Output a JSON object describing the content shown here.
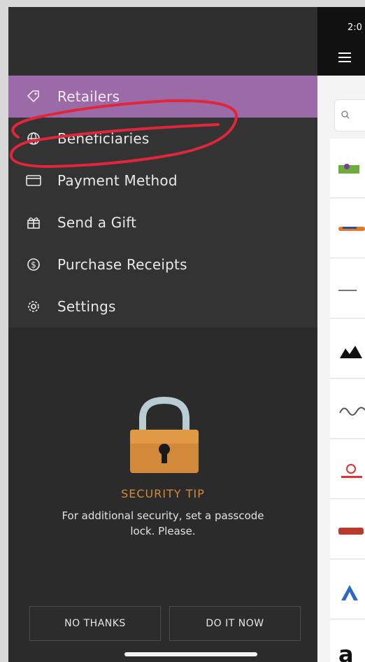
{
  "status_bar": {
    "time": "2:0"
  },
  "menu": {
    "items": [
      {
        "label": "Retailers",
        "icon": "tag-icon",
        "active": true
      },
      {
        "label": "Beneficiaries",
        "icon": "globe-icon",
        "active": false
      },
      {
        "label": "Payment Method",
        "icon": "card-icon",
        "active": false
      },
      {
        "label": "Send a Gift",
        "icon": "gift-icon",
        "active": false
      },
      {
        "label": "Purchase Receipts",
        "icon": "dollar-circle-icon",
        "active": false
      },
      {
        "label": "Settings",
        "icon": "gear-icon",
        "active": false
      }
    ]
  },
  "security_tip": {
    "title": "SECURITY TIP",
    "body": "For additional security, set a passcode lock. Please.",
    "no_thanks": "NO THANKS",
    "do_it_now": "DO IT NOW"
  },
  "colors": {
    "active_item": "#9b6ba8",
    "tip_title": "#d38a3a",
    "annotation": "#e0263a"
  }
}
